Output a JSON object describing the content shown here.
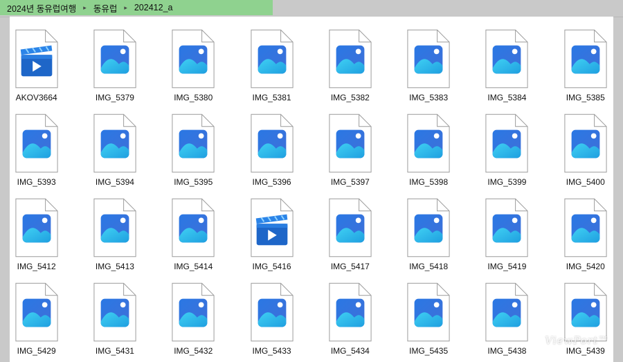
{
  "breadcrumb": [
    "2024년 동유럽여행",
    "동유럽",
    "202412_a"
  ],
  "colors": {
    "breadcrumb_bg": "#8fd28f",
    "photo_icon_top": "#2f80ed",
    "photo_icon_mountain": "#38c6ef",
    "video_icon": "#1e66c8"
  },
  "files": [
    {
      "name": "AKOV3664",
      "type": "video"
    },
    {
      "name": "IMG_5379",
      "type": "image"
    },
    {
      "name": "IMG_5380",
      "type": "image"
    },
    {
      "name": "IMG_5381",
      "type": "image"
    },
    {
      "name": "IMG_5382",
      "type": "image"
    },
    {
      "name": "IMG_5383",
      "type": "image"
    },
    {
      "name": "IMG_5384",
      "type": "image"
    },
    {
      "name": "IMG_5385",
      "type": "image"
    },
    {
      "name": "IMG_5393",
      "type": "image"
    },
    {
      "name": "IMG_5394",
      "type": "image"
    },
    {
      "name": "IMG_5395",
      "type": "image"
    },
    {
      "name": "IMG_5396",
      "type": "image"
    },
    {
      "name": "IMG_5397",
      "type": "image"
    },
    {
      "name": "IMG_5398",
      "type": "image"
    },
    {
      "name": "IMG_5399",
      "type": "image"
    },
    {
      "name": "IMG_5400",
      "type": "image"
    },
    {
      "name": "IMG_5412",
      "type": "image"
    },
    {
      "name": "IMG_5413",
      "type": "image"
    },
    {
      "name": "IMG_5414",
      "type": "image"
    },
    {
      "name": "IMG_5416",
      "type": "video"
    },
    {
      "name": "IMG_5417",
      "type": "image"
    },
    {
      "name": "IMG_5418",
      "type": "image"
    },
    {
      "name": "IMG_5419",
      "type": "image"
    },
    {
      "name": "IMG_5420",
      "type": "image"
    },
    {
      "name": "IMG_5429",
      "type": "image"
    },
    {
      "name": "IMG_5431",
      "type": "image"
    },
    {
      "name": "IMG_5432",
      "type": "image"
    },
    {
      "name": "IMG_5433",
      "type": "image"
    },
    {
      "name": "IMG_5434",
      "type": "image"
    },
    {
      "name": "IMG_5435",
      "type": "image"
    },
    {
      "name": "IMG_5438",
      "type": "image"
    },
    {
      "name": "IMG_5439",
      "type": "image"
    }
  ],
  "watermark": "ViewPort™"
}
